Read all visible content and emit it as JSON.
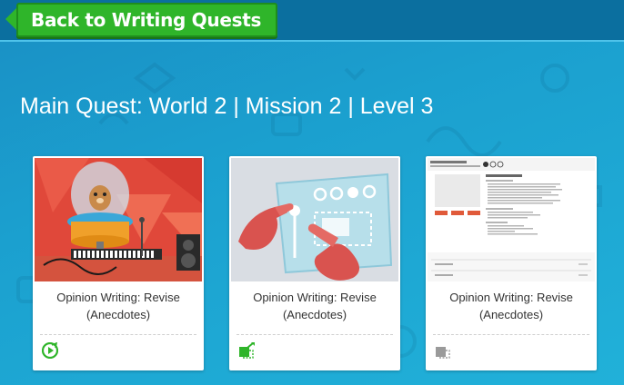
{
  "header": {
    "back_label": "Back to Writing Quests"
  },
  "page": {
    "title": "Main Quest: World 2 | Mission 2 | Level 3"
  },
  "cards": [
    {
      "title_line1": "Opinion Writing: Revise",
      "title_line2": "(Anecdotes)",
      "thumbnail": "hamster-music-studio-illustration",
      "status_icon": "green-play-icon"
    },
    {
      "title_line1": "Opinion Writing: Revise",
      "title_line2": "(Anecdotes)",
      "thumbnail": "hands-touching-control-panel-illustration",
      "status_icon": "green-drag-drop-icon"
    },
    {
      "title_line1": "Opinion Writing: Revise",
      "title_line2": "(Anecdotes)",
      "thumbnail": "lesson-document-preview",
      "status_icon": "gray-drag-drop-icon"
    }
  ],
  "colors": {
    "background": "#1ba0cf",
    "topbar": "#0b6f9f",
    "back_button": "#2fb52a",
    "status_green": "#2fb52a",
    "status_gray": "#9a9a9a"
  }
}
